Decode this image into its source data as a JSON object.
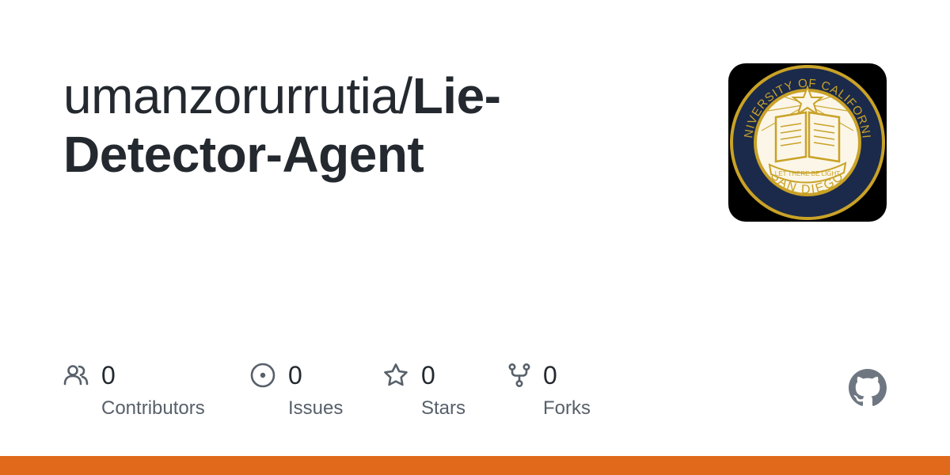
{
  "repo": {
    "owner": "umanzorurrutia/",
    "name_line1": "Lie-",
    "name_line2": "Detector-Agent"
  },
  "avatar": {
    "icon": "university-seal-icon",
    "seal_top_text": "UNIVERSITY OF CALIFORNIA",
    "seal_bottom_text": "SAN DIEGO",
    "motto": "LET THERE BE LIGHT",
    "colors": {
      "background": "#000000",
      "ring": "#1b2a4a",
      "gold": "#c9a227"
    }
  },
  "stats": [
    {
      "icon": "people-icon",
      "count": "0",
      "label": "Contributors"
    },
    {
      "icon": "issue-opened-icon",
      "count": "0",
      "label": "Issues"
    },
    {
      "icon": "star-icon",
      "count": "0",
      "label": "Stars"
    },
    {
      "icon": "fork-icon",
      "count": "0",
      "label": "Forks"
    }
  ],
  "brand": {
    "icon": "github-mark-icon"
  },
  "colors": {
    "accent_bar": "#e0691b",
    "text_primary": "#24292f",
    "text_secondary": "#57606a",
    "icon_gray": "#57606a"
  }
}
